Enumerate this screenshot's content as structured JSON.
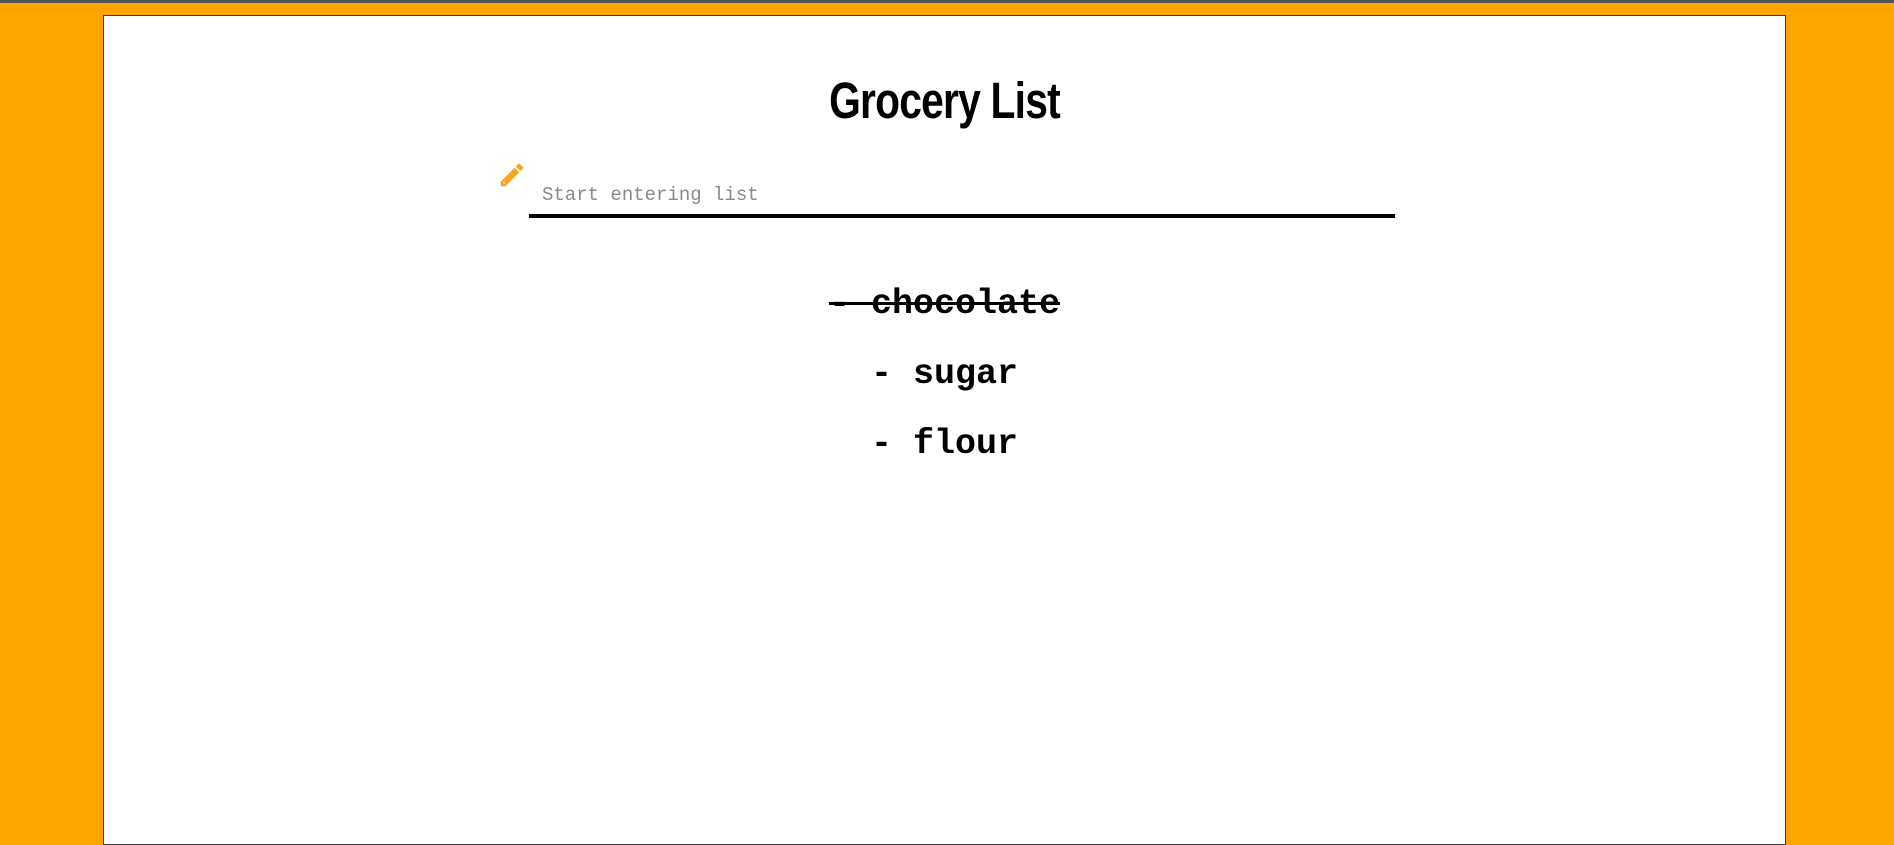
{
  "app": {
    "title": "Grocery List"
  },
  "entry": {
    "placeholder": "Start entering list",
    "value": "",
    "icon": "pencil-icon"
  },
  "items": [
    {
      "label": "- chocolate",
      "checked": true
    },
    {
      "label": "- sugar",
      "checked": false
    },
    {
      "label": "- flour",
      "checked": false
    }
  ],
  "colors": {
    "background": "#FFA500",
    "paper": "#FFFFFF",
    "accent": "#F5A623",
    "text": "#000000",
    "placeholder": "#8A8A8A"
  }
}
